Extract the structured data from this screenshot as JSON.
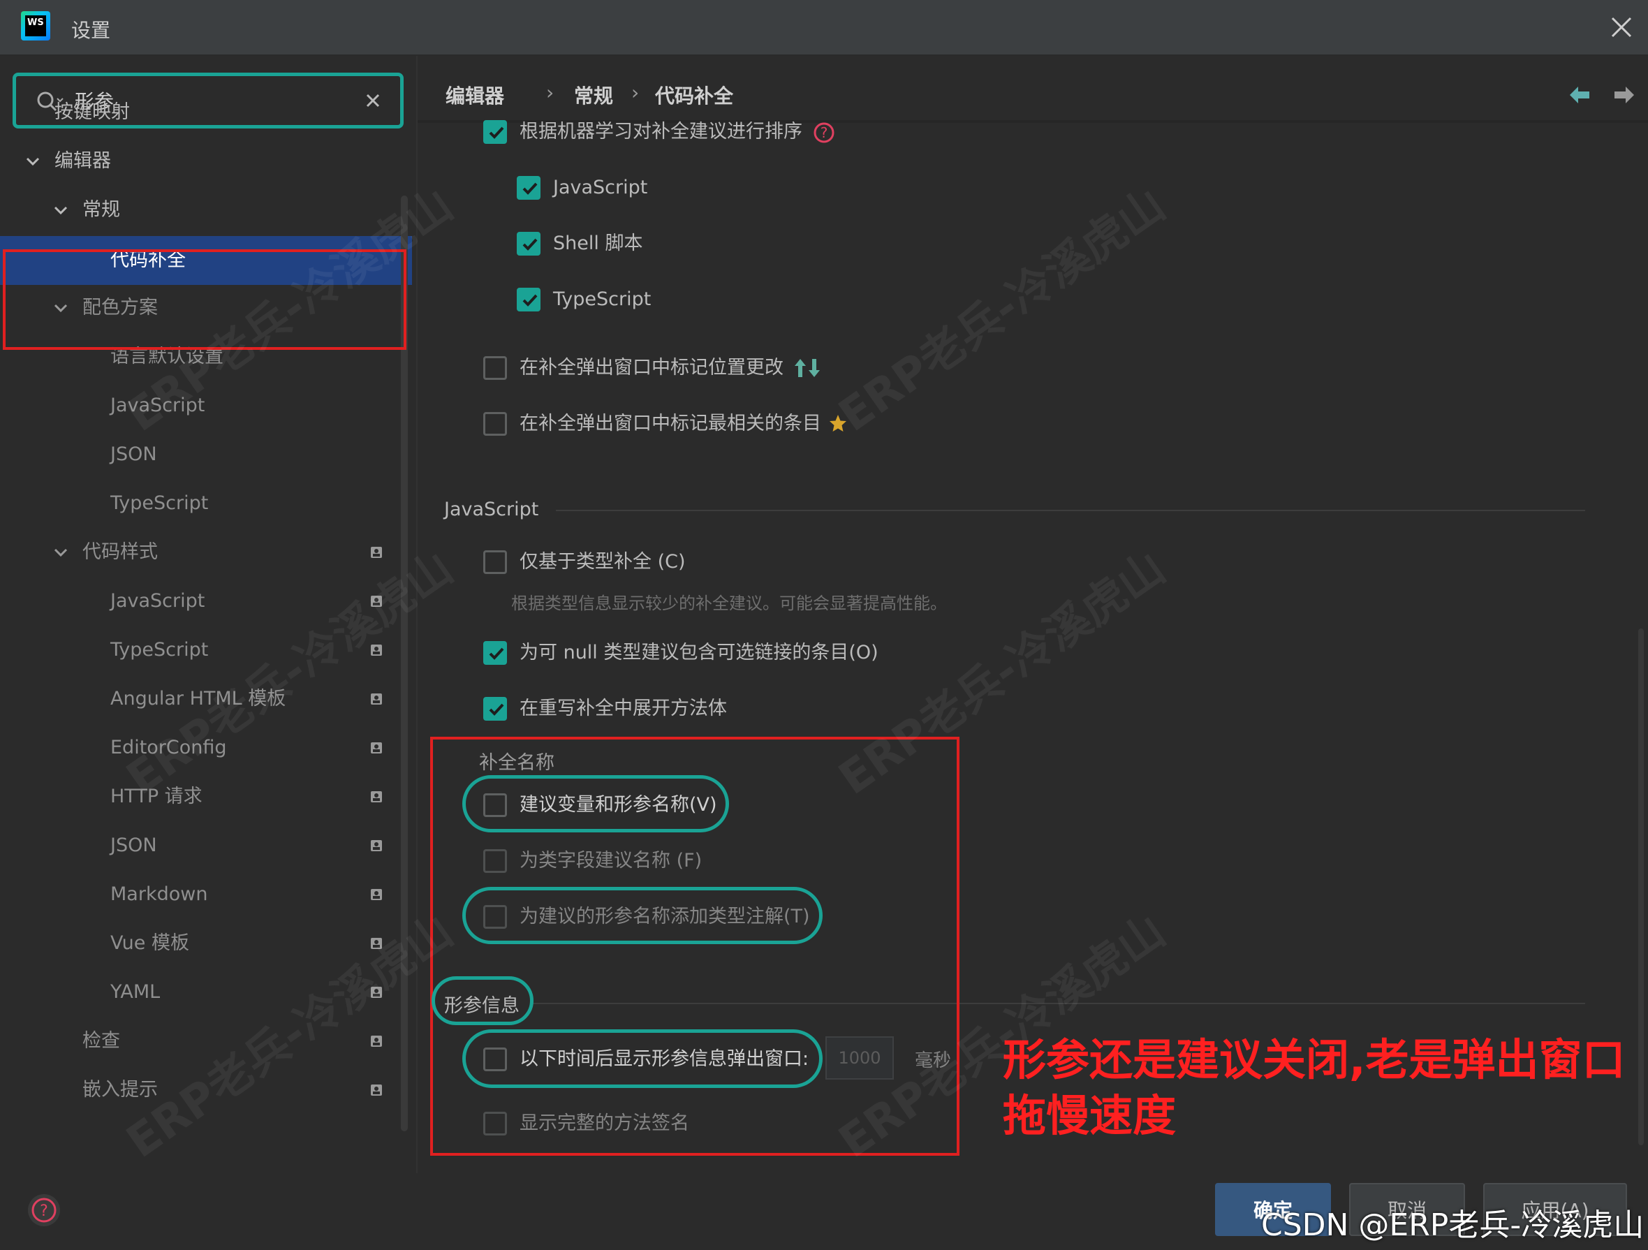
{
  "window": {
    "title": "设置",
    "logo_text": "WS"
  },
  "search": {
    "value": "形参"
  },
  "sidebar": {
    "items": [
      {
        "label": "按键映射"
      },
      {
        "label": "编辑器"
      },
      {
        "label": "常规"
      },
      {
        "label": "代码补全"
      },
      {
        "label": "配色方案"
      },
      {
        "label": "语言默认设置"
      },
      {
        "label": "JavaScript"
      },
      {
        "label": "JSON"
      },
      {
        "label": "TypeScript"
      },
      {
        "label": "代码样式"
      },
      {
        "label": "JavaScript"
      },
      {
        "label": "TypeScript"
      },
      {
        "label": "Angular HTML 模板"
      },
      {
        "label": "EditorConfig"
      },
      {
        "label": "HTTP 请求"
      },
      {
        "label": "JSON"
      },
      {
        "label": "Markdown"
      },
      {
        "label": "Vue 模板"
      },
      {
        "label": "YAML"
      },
      {
        "label": "检查"
      },
      {
        "label": "嵌入提示"
      }
    ]
  },
  "breadcrumb": {
    "part1": "编辑器",
    "part2": "常规",
    "part3": "代码补全",
    "sep": "›"
  },
  "options": {
    "ml_sort": "根据机器学习对补全建议进行排序",
    "ml_js": "JavaScript",
    "ml_shell": "Shell 脚本",
    "ml_ts": "TypeScript",
    "mark_position": "在补全弹出窗口中标记位置更改",
    "mark_relevant": "在补全弹出窗口中标记最相关的条目",
    "js_section": "JavaScript",
    "type_based": "仅基于类型补全 (C)",
    "type_based_hint": "根据类型信息显示较少的补全建议。可能会显著提高性能。",
    "nullable": "为可 null 类型建议包含可选链接的条目(O)",
    "expand_override": "在重写补全中展开方法体",
    "names_section": "补全名称",
    "suggest_names": "建议变量和形参名称(V)",
    "class_fields": "为类字段建议名称 (F)",
    "type_annot": "为建议的形参名称添加类型注解(T)",
    "param_section": "形参信息",
    "param_popup": "以下时间后显示形参信息弹出窗口:",
    "param_delay": "1000",
    "param_unit": "毫秒",
    "full_signature": "显示完整的方法签名"
  },
  "annotation": {
    "line1": "形参还是建议关闭,老是弹出窗口",
    "line2": "拖慢速度"
  },
  "footer": {
    "ok": "确定",
    "cancel": "取消",
    "apply": "应用(A)"
  },
  "watermark": {
    "csdn": "CSDN @ERP老兵-冷溪虎山",
    "text": "ERP老兵-冷溪虎山"
  },
  "colors": {
    "accent": "#1aa395",
    "selection": "#214283",
    "annotation": "#e02020",
    "primary_button": "#365880"
  }
}
